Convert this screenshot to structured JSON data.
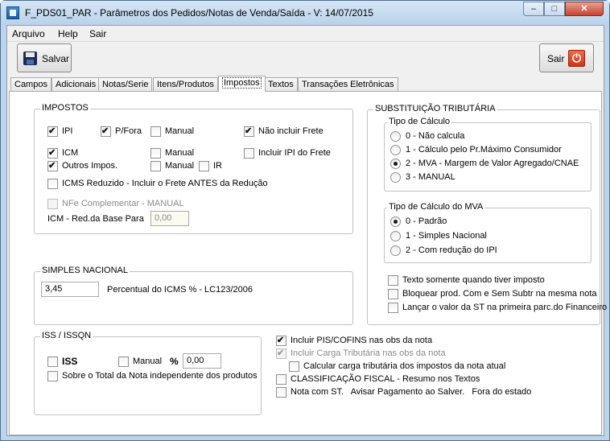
{
  "window": {
    "title": "F_PDS01_PAR - Parâmetros dos Pedidos/Notas de Venda/Saída - V: 14/07/2015",
    "close_glyph": "✕",
    "min_glyph": "–",
    "max_glyph": "□"
  },
  "menu": {
    "arquivo": "Arquivo",
    "help": "Help",
    "sair": "Sair"
  },
  "toolbar": {
    "save_label": "Salvar",
    "exit_label": "Sair",
    "power_glyph": "⏻"
  },
  "tabs": [
    "Campos",
    "Adicionais",
    "Notas/Serie",
    "Itens/Produtos",
    "Impostos",
    "Textos",
    "Transações Eletrônicas"
  ],
  "impostos": {
    "title": "IMPOSTOS",
    "ipi": "IPI",
    "pfora": "P/Fora",
    "manual1": "Manual",
    "nao_incluir_frete": "Não incluir Frete",
    "icm": "ICM",
    "manual2": "Manual",
    "incluir_ipi_frete": "Incluir IPI do Frete",
    "outros_impos": "Outros Impos.",
    "manual3": "Manual",
    "ir": "IR",
    "icms_reduzido": "ICMS Reduzido - Incluir o Frete ANTES da Redução",
    "nfe_complementar": "NFe Complementar - MANUAL",
    "icm_red_label": "ICM - Red.da Base Para",
    "icm_red_value": "0,00"
  },
  "simples": {
    "title": "SIMPLES NACIONAL",
    "value": "3,45",
    "label": "Percentual do ICMS % - LC123/2006"
  },
  "iss": {
    "title": "ISS / ISSQN",
    "iss": "ISS",
    "manual": "Manual",
    "percent": "%",
    "value": "0,00",
    "sobre_total": "Sobre o Total da Nota independente dos produtos"
  },
  "st": {
    "title": "SUBSTITUIÇÃO TRIBUTÁRIA",
    "tipo_calculo": "Tipo de Cálculo",
    "opt0": "0 - Não calcula",
    "opt1": "1 - Cálculo pelo Pr.Máximo Consumidor",
    "opt2": "2 - MVA - Margem de Valor Agregado/CNAE",
    "opt3": "3 - MANUAL",
    "tipo_mva": "Tipo de Cálculo do MVA",
    "mva0": "0 - Padrão",
    "mva1": "1 - Simples Nacional",
    "mva2": "2 - Com redução do IPI",
    "texto_somente": "Texto somente quando tiver imposto",
    "bloquear": "Bloquear prod. Com e Sem Subtr na mesma nota",
    "lancar": "Lançar o valor da ST na primeira parc.do Financeiro"
  },
  "bottom": {
    "incluir_pis": "Incluir PIS/COFINS nas obs da nota",
    "incluir_carga": "Incluir Carga Tributária nas obs da nota",
    "calcular_carga": "Calcular carga tributária dos impostos da nota atual",
    "classificacao": "CLASSIFICAÇÃO FISCAL - Resumo nos Textos",
    "nota_st": "Nota com ST.   Avisar Pagamento ao Salver.   Fora do estado"
  }
}
